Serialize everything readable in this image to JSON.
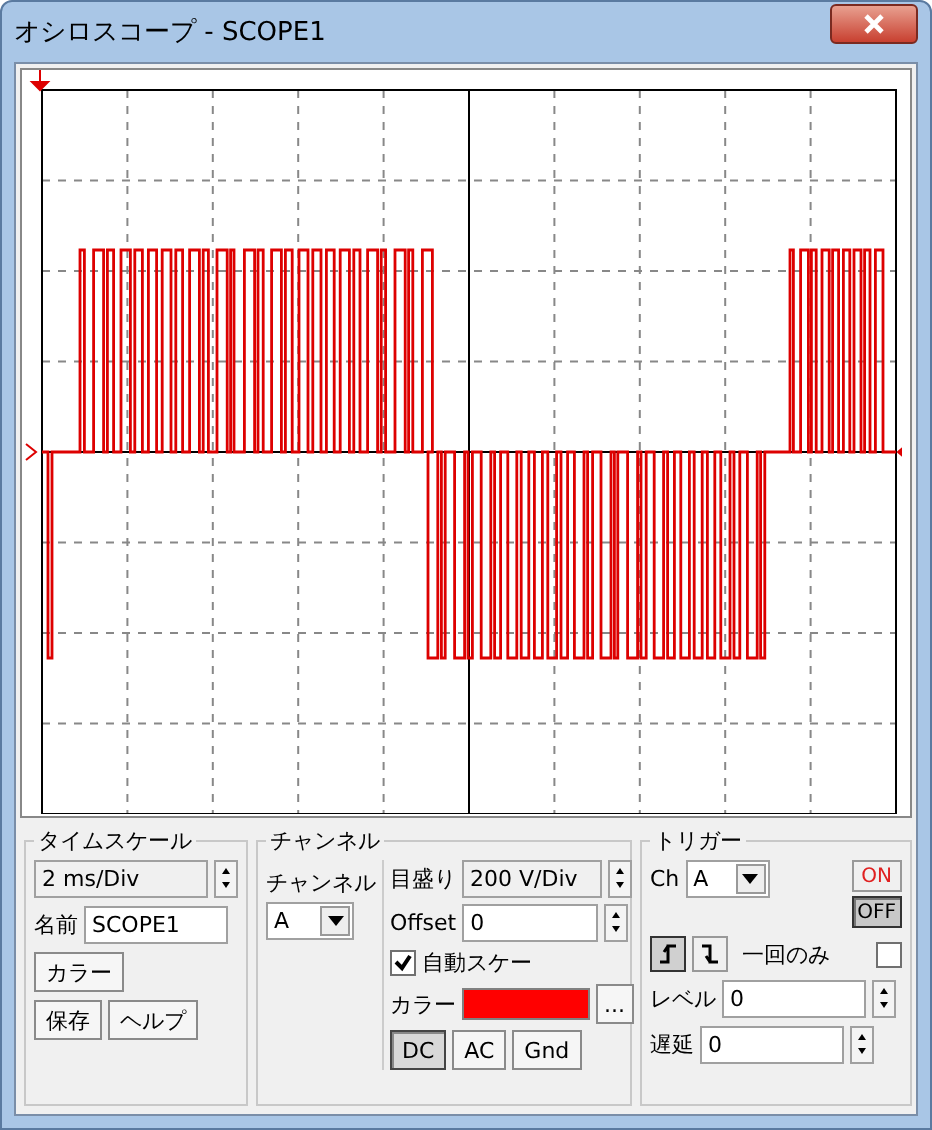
{
  "window": {
    "title": "オシロスコープ - SCOPE1"
  },
  "time_scale": {
    "legend": "タイムスケール",
    "value": "2 ms/Div",
    "name_label": "名前",
    "name_value": "SCOPE1",
    "buttons": [
      "カラー",
      "保存",
      "ヘルプ"
    ]
  },
  "channel": {
    "legend": "チャンネル",
    "select_label": "チャンネル",
    "select_value": "A",
    "scale_label": "目盛り",
    "scale_value": "200  V/Div",
    "offset_label": "Offset",
    "offset_value": "0",
    "auto_scale": {
      "label": "自動スケー",
      "checked": true
    },
    "color_label": "カラー",
    "color": "#ff0000",
    "more": "...",
    "coupling": [
      {
        "label": "DC",
        "selected": true
      },
      {
        "label": "AC",
        "selected": false
      },
      {
        "label": "Gnd",
        "selected": false
      }
    ]
  },
  "trigger": {
    "legend": "トリガー",
    "ch_label": "Ch",
    "ch_value": "A",
    "power": [
      {
        "label": "ON",
        "selected": false
      },
      {
        "label": "OFF",
        "selected": true
      }
    ],
    "edges": [
      {
        "kind": "rising",
        "selected": true
      },
      {
        "kind": "falling",
        "selected": false
      }
    ],
    "once": {
      "label": "一回のみ",
      "checked": false
    },
    "level_label": "レベル",
    "level_value": "0",
    "delay_label": "遅延",
    "delay_value": "0"
  }
}
